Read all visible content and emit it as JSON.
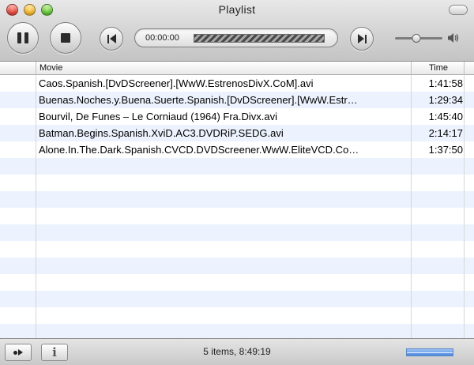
{
  "window": {
    "title": "Playlist"
  },
  "player": {
    "current_time": "00:00:00",
    "progress": 0,
    "volume": 0.45
  },
  "table": {
    "columns": [
      "Movie",
      "Time"
    ],
    "rows": [
      {
        "title": "Caos.Spanish.[DvDScreener].[WwW.EstrenosDivX.CoM].avi",
        "time": "1:41:58"
      },
      {
        "title": "Buenas.Noches.y.Buena.Suerte.Spanish.[DvDScreener].[WwW.Estr…",
        "time": "1:29:34"
      },
      {
        "title": "Bourvil, De Funes – Le Corniaud (1964) Fra.Divx.avi",
        "time": "1:45:40"
      },
      {
        "title": "Batman.Begins.Spanish.XviD.AC3.DVDRiP.SEDG.avi",
        "time": "2:14:17"
      },
      {
        "title": "Alone.In.The.Dark.Spanish.CVCD.DVDScreener.WwW.EliteVCD.Co…",
        "time": "1:37:50"
      }
    ]
  },
  "footer": {
    "status": "5 items, 8:49:19",
    "info_label": "i"
  },
  "colors": {
    "row_stripe": "#edf3fe",
    "activity": "#4b86dc"
  }
}
